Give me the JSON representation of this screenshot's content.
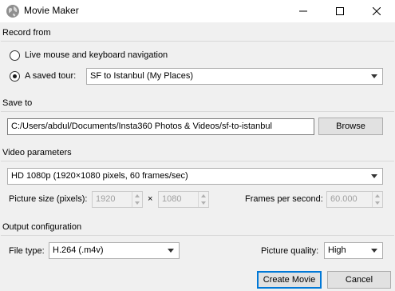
{
  "window": {
    "title": "Movie Maker",
    "icon": "earth-globe-icon",
    "controls": [
      "minimize-icon",
      "maximize-icon",
      "close-icon"
    ]
  },
  "record_from": {
    "label": "Record from",
    "option_live": "Live mouse and keyboard navigation",
    "option_tour": "A saved tour:",
    "selected_option": "A saved tour:",
    "tour_value": "SF to Istanbul (My Places)"
  },
  "save_to": {
    "label": "Save to",
    "path": "C:/Users/abdul/Documents/Insta360 Photos & Videos/sf-to-istanbul",
    "browse_label": "Browse"
  },
  "video_parameters": {
    "label": "Video parameters",
    "preset": "HD 1080p (1920×1080 pixels, 60 frames/sec)",
    "picture_size_label": "Picture size (pixels):",
    "width": "1920",
    "times": "×",
    "height": "1080",
    "fps_label": "Frames per second:",
    "fps": "60.000"
  },
  "output": {
    "label": "Output configuration",
    "file_type_label": "File type:",
    "file_type": "H.264 (.m4v)",
    "quality_label": "Picture quality:",
    "quality": "High"
  },
  "actions": {
    "create_label": "Create Movie",
    "cancel_label": "Cancel"
  },
  "colors": {
    "accent": "#0078d7",
    "window_bg": "#f0f0f0"
  }
}
